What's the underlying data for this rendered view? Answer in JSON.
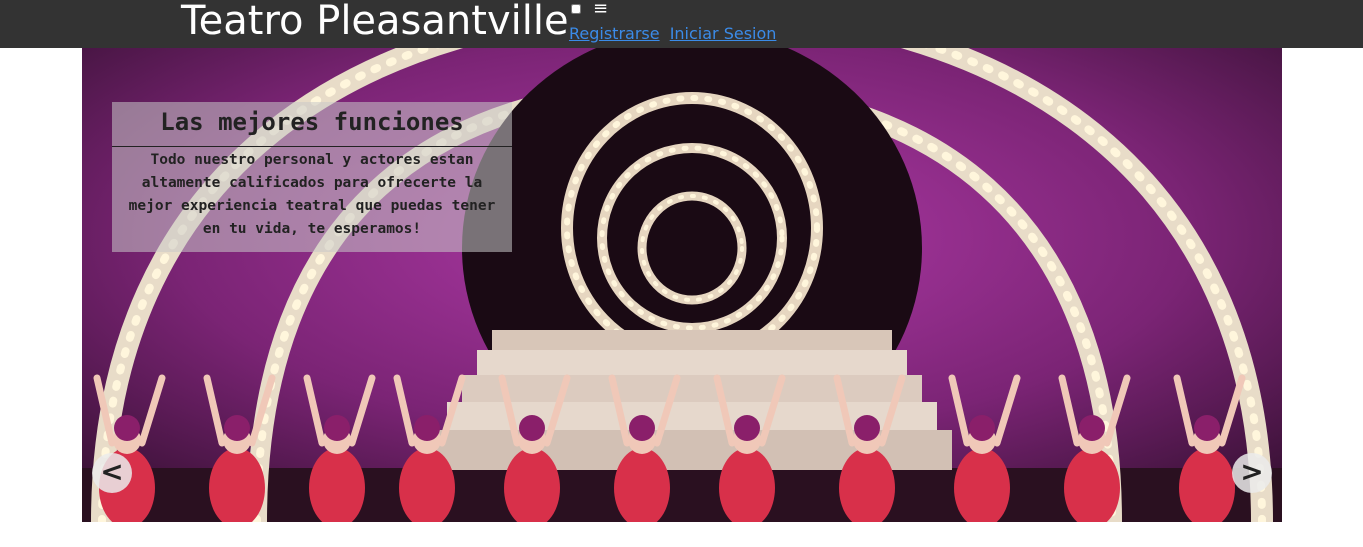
{
  "header": {
    "brand": "Teatro Pleasantville",
    "menu_icon": "hamburger-icon",
    "menu_icon_glyph": "≡",
    "links": {
      "register": "Registrarse",
      "login": "Iniciar Sesion"
    }
  },
  "slider": {
    "caption": {
      "title": "Las mejores funciones",
      "text": "Todo nuestro personal y actores estan altamente calificados para ofrecerte la mejor experiencia teatral que puedas tener en tu vida, te esperamos!"
    },
    "prev_label": "<",
    "next_label": ">",
    "image_subject": "theater-stage-photo"
  },
  "colors": {
    "header_bg": "#333333",
    "link": "#3b8be8"
  }
}
